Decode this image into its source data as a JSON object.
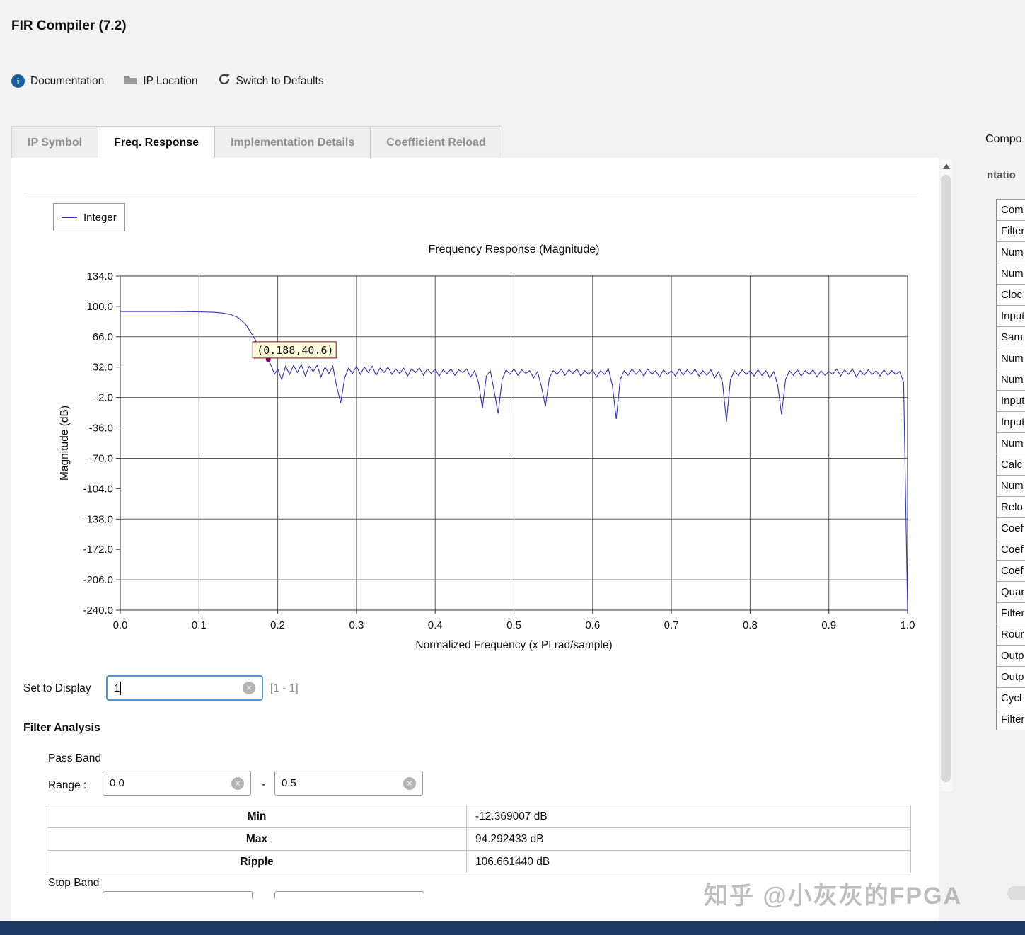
{
  "page": {
    "title": "FIR Compiler (7.2)"
  },
  "toolbar": {
    "documentation": "Documentation",
    "ip_location": "IP Location",
    "switch_to_defaults": "Switch to Defaults"
  },
  "tabs": [
    {
      "label": "IP Symbol",
      "active": false
    },
    {
      "label": "Freq. Response",
      "active": true
    },
    {
      "label": "Implementation Details",
      "active": false
    },
    {
      "label": "Coefficient Reload",
      "active": false
    }
  ],
  "right_panel": {
    "header": "Compo",
    "subheader": "ntatio",
    "rows": [
      "Com",
      "Filter",
      "Num",
      "Num",
      "Cloc",
      "Input",
      "Sam",
      "Num",
      "Num",
      "Input",
      "Input",
      "Num",
      "Calc",
      "Num",
      "Relo",
      "Coef",
      "Coef",
      "Coef",
      "Quar",
      "Filter",
      "Rour",
      "Outp",
      "Outp",
      "Cycl",
      "Filter"
    ]
  },
  "display": {
    "label": "Set to Display",
    "value": "1",
    "range_hint": "[1 - 1]"
  },
  "filter_analysis": {
    "heading": "Filter Analysis",
    "pass_band": {
      "label": "Pass Band",
      "range_label": "Range :",
      "from": "0.0",
      "separator": "-",
      "to": "0.5"
    },
    "results": [
      {
        "name": "Min",
        "value": "-12.369007 dB"
      },
      {
        "name": "Max",
        "value": "94.292433 dB"
      },
      {
        "name": "Ripple",
        "value": "106.661440 dB"
      }
    ],
    "stop_band_label": "Stop Band"
  },
  "watermark": "知乎 @小灰灰的FPGA",
  "colors": {
    "line": "#3333bb",
    "annotation_bg": "#ffffe0",
    "annotation_border": "#990000",
    "focus_border": "#4f94d4",
    "bottom_bar": "#1d3a66"
  },
  "chart_data": {
    "type": "line",
    "title": "Frequency Response (Magnitude)",
    "xlabel": "Normalized Frequency (x PI rad/sample)",
    "ylabel": "Magnitude (dB)",
    "xlim": [
      0.0,
      1.0
    ],
    "ylim": [
      -240.0,
      134.0
    ],
    "x_ticks": [
      0.0,
      0.1,
      0.2,
      0.3,
      0.4,
      0.5,
      0.6,
      0.7,
      0.8,
      0.9,
      1.0
    ],
    "y_ticks": [
      134.0,
      100.0,
      66.0,
      32.0,
      -2.0,
      -36.0,
      -70.0,
      -104.0,
      -138.0,
      -172.0,
      -206.0,
      -240.0
    ],
    "grid": true,
    "legend_position": "top-left",
    "legend": [
      {
        "name": "Integer",
        "color": "#3333bb"
      }
    ],
    "annotation": {
      "x": 0.188,
      "y": 40.6,
      "label": "(0.188,40.6)"
    },
    "series": [
      {
        "name": "Integer",
        "color": "#3333bb",
        "points": [
          [
            0.0,
            94.3
          ],
          [
            0.02,
            94.3
          ],
          [
            0.04,
            94.3
          ],
          [
            0.06,
            94.3
          ],
          [
            0.08,
            94.2
          ],
          [
            0.1,
            94.0
          ],
          [
            0.12,
            93.4
          ],
          [
            0.13,
            92.6
          ],
          [
            0.14,
            91.0
          ],
          [
            0.15,
            87.5
          ],
          [
            0.16,
            79.0
          ],
          [
            0.17,
            65.0
          ],
          [
            0.18,
            49.0
          ],
          [
            0.188,
            40.6
          ],
          [
            0.192,
            33.0
          ],
          [
            0.196,
            24.0
          ],
          [
            0.2,
            30
          ],
          [
            0.205,
            18
          ],
          [
            0.21,
            33
          ],
          [
            0.215,
            24
          ],
          [
            0.22,
            34
          ],
          [
            0.225,
            26
          ],
          [
            0.23,
            35
          ],
          [
            0.235,
            22
          ],
          [
            0.24,
            33
          ],
          [
            0.245,
            27
          ],
          [
            0.25,
            34
          ],
          [
            0.255,
            21
          ],
          [
            0.26,
            32
          ],
          [
            0.265,
            25
          ],
          [
            0.27,
            33
          ],
          [
            0.275,
            10
          ],
          [
            0.28,
            -8
          ],
          [
            0.285,
            20
          ],
          [
            0.29,
            31
          ],
          [
            0.295,
            25
          ],
          [
            0.3,
            33
          ],
          [
            0.305,
            24
          ],
          [
            0.31,
            32
          ],
          [
            0.315,
            26
          ],
          [
            0.32,
            33
          ],
          [
            0.325,
            23
          ],
          [
            0.33,
            31
          ],
          [
            0.335,
            26
          ],
          [
            0.34,
            32
          ],
          [
            0.345,
            24
          ],
          [
            0.35,
            30
          ],
          [
            0.355,
            25
          ],
          [
            0.36,
            31
          ],
          [
            0.365,
            22
          ],
          [
            0.37,
            30
          ],
          [
            0.375,
            26
          ],
          [
            0.38,
            31
          ],
          [
            0.385,
            23
          ],
          [
            0.39,
            30
          ],
          [
            0.395,
            25
          ],
          [
            0.4,
            30
          ],
          [
            0.405,
            22
          ],
          [
            0.41,
            29
          ],
          [
            0.415,
            25
          ],
          [
            0.42,
            30
          ],
          [
            0.425,
            23
          ],
          [
            0.43,
            29
          ],
          [
            0.435,
            26
          ],
          [
            0.44,
            30
          ],
          [
            0.445,
            21
          ],
          [
            0.45,
            28
          ],
          [
            0.455,
            15
          ],
          [
            0.46,
            -14
          ],
          [
            0.465,
            22
          ],
          [
            0.47,
            28
          ],
          [
            0.475,
            5
          ],
          [
            0.48,
            -20
          ],
          [
            0.485,
            18
          ],
          [
            0.49,
            29
          ],
          [
            0.495,
            24
          ],
          [
            0.5,
            30
          ],
          [
            0.505,
            23
          ],
          [
            0.51,
            29
          ],
          [
            0.515,
            25
          ],
          [
            0.52,
            28
          ],
          [
            0.525,
            20
          ],
          [
            0.53,
            27
          ],
          [
            0.535,
            10
          ],
          [
            0.54,
            -12
          ],
          [
            0.545,
            20
          ],
          [
            0.55,
            28
          ],
          [
            0.555,
            24
          ],
          [
            0.56,
            30
          ],
          [
            0.565,
            23
          ],
          [
            0.57,
            29
          ],
          [
            0.575,
            25
          ],
          [
            0.58,
            30
          ],
          [
            0.585,
            22
          ],
          [
            0.59,
            28
          ],
          [
            0.595,
            24
          ],
          [
            0.6,
            29
          ],
          [
            0.605,
            21
          ],
          [
            0.61,
            28
          ],
          [
            0.615,
            24
          ],
          [
            0.62,
            30
          ],
          [
            0.625,
            12
          ],
          [
            0.63,
            -26
          ],
          [
            0.635,
            18
          ],
          [
            0.64,
            28
          ],
          [
            0.645,
            23
          ],
          [
            0.65,
            30
          ],
          [
            0.655,
            24
          ],
          [
            0.66,
            29
          ],
          [
            0.665,
            22
          ],
          [
            0.67,
            30
          ],
          [
            0.675,
            24
          ],
          [
            0.68,
            28
          ],
          [
            0.685,
            21
          ],
          [
            0.69,
            29
          ],
          [
            0.695,
            24
          ],
          [
            0.7,
            28
          ],
          [
            0.705,
            22
          ],
          [
            0.71,
            30
          ],
          [
            0.715,
            23
          ],
          [
            0.72,
            29
          ],
          [
            0.725,
            24
          ],
          [
            0.73,
            30
          ],
          [
            0.735,
            22
          ],
          [
            0.74,
            28
          ],
          [
            0.745,
            23
          ],
          [
            0.75,
            29
          ],
          [
            0.755,
            20
          ],
          [
            0.76,
            27
          ],
          [
            0.765,
            15
          ],
          [
            0.77,
            -29
          ],
          [
            0.775,
            18
          ],
          [
            0.78,
            28
          ],
          [
            0.785,
            23
          ],
          [
            0.79,
            29
          ],
          [
            0.795,
            24
          ],
          [
            0.8,
            28
          ],
          [
            0.805,
            22
          ],
          [
            0.81,
            29
          ],
          [
            0.815,
            23
          ],
          [
            0.82,
            28
          ],
          [
            0.825,
            20
          ],
          [
            0.83,
            27
          ],
          [
            0.835,
            12
          ],
          [
            0.84,
            -21
          ],
          [
            0.845,
            18
          ],
          [
            0.85,
            28
          ],
          [
            0.855,
            23
          ],
          [
            0.86,
            29
          ],
          [
            0.865,
            22
          ],
          [
            0.87,
            28
          ],
          [
            0.875,
            24
          ],
          [
            0.88,
            29
          ],
          [
            0.885,
            21
          ],
          [
            0.89,
            28
          ],
          [
            0.895,
            23
          ],
          [
            0.9,
            27
          ],
          [
            0.905,
            24
          ],
          [
            0.91,
            30
          ],
          [
            0.915,
            22
          ],
          [
            0.92,
            29
          ],
          [
            0.925,
            24
          ],
          [
            0.93,
            30
          ],
          [
            0.935,
            21
          ],
          [
            0.94,
            28
          ],
          [
            0.945,
            23
          ],
          [
            0.95,
            29
          ],
          [
            0.955,
            24
          ],
          [
            0.96,
            28
          ],
          [
            0.965,
            22
          ],
          [
            0.97,
            29
          ],
          [
            0.975,
            23
          ],
          [
            0.98,
            28
          ],
          [
            0.985,
            24
          ],
          [
            0.99,
            27
          ],
          [
            0.995,
            15
          ],
          [
            1.0,
            -240
          ]
        ]
      }
    ]
  }
}
